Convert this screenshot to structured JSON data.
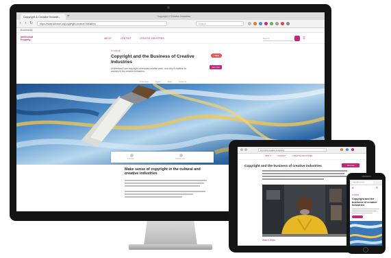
{
  "desktop": {
    "window_title": "Copyright & Creative Industries",
    "tab_label": "Copyright & Creative Industri...",
    "url": "https://www.scheme.org/copyright-creative-industries",
    "search_placeholder": "Search",
    "bookmarks": "Bookmarks",
    "site": {
      "logo": "Intellectual Property",
      "nav": [
        "ABOUT",
        "CONTENT",
        "CREATIVE INDUSTRIES"
      ],
      "search_placeholder": "Search",
      "menu_glyph": "≡"
    },
    "hero": {
      "kicker": "COURSE",
      "title": "Copyright and the Business of Creative Industries",
      "description": "Understand how copyright underpins creative work, and why it matters for careers in the creative industries.",
      "badge": "FREE",
      "cta": "Join now"
    },
    "subnav": [
      "Overview",
      "Topics",
      "Start",
      "Lessons"
    ],
    "cards": [
      "Duration",
      "Course type"
    ],
    "article_title": "Make sense of copyright in the cultural and creative industries"
  },
  "tablet": {
    "url": "copyright-creative-industries",
    "nav": [
      "ABOUT",
      "CONTENT",
      "CREATIVE INDUSTRIES"
    ],
    "title": "Copyright and the business of creative industries",
    "button": "Join now",
    "footer": "Watch video"
  },
  "phone": {
    "url": "copyright-creative...",
    "logo": "IP",
    "menu_glyph": "≡",
    "kicker": "COURSE",
    "title": "Copyright and the business of creative industries"
  },
  "colors": {
    "brand": "#c0287a",
    "badge": "#e5564d"
  }
}
